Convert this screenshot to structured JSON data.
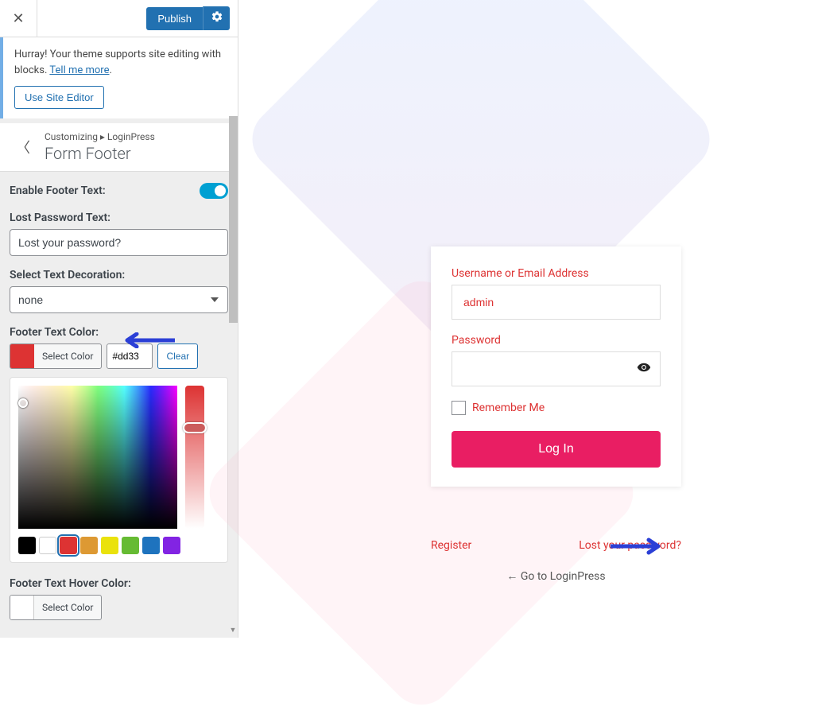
{
  "topbar": {
    "publish_label": "Publish"
  },
  "notice": {
    "text_a": "Hurray! Your theme supports site editing with blocks. ",
    "link_label": "Tell me more",
    "site_editor_label": "Use Site Editor"
  },
  "breadcrumb": {
    "line": "Customizing ▸ LoginPress",
    "title": "Form Footer"
  },
  "controls": {
    "enable_footer_label": "Enable Footer Text:",
    "lost_password_label": "Lost Password Text:",
    "lost_password_value": "Lost your password?",
    "text_decoration_label": "Select Text Decoration:",
    "text_decoration_value": "none",
    "footer_text_color_label": "Footer Text Color:",
    "select_color_label": "Select Color",
    "hex_value": "#dd33",
    "clear_label": "Clear",
    "footer_hover_label": "Footer Text Hover Color:"
  },
  "palette": [
    "#000000",
    "#ffffff",
    "#dd3333",
    "#dd9933",
    "#eae20c",
    "#66bb33",
    "#1e73be",
    "#8224e3"
  ],
  "login": {
    "username_label": "Username or Email Address",
    "username_value": "admin",
    "password_label": "Password",
    "remember_label": "Remember Me",
    "login_btn_label": "Log In",
    "register_label": "Register",
    "lost_label": "Lost your password?",
    "backlink_label": "← Go to LoginPress"
  }
}
